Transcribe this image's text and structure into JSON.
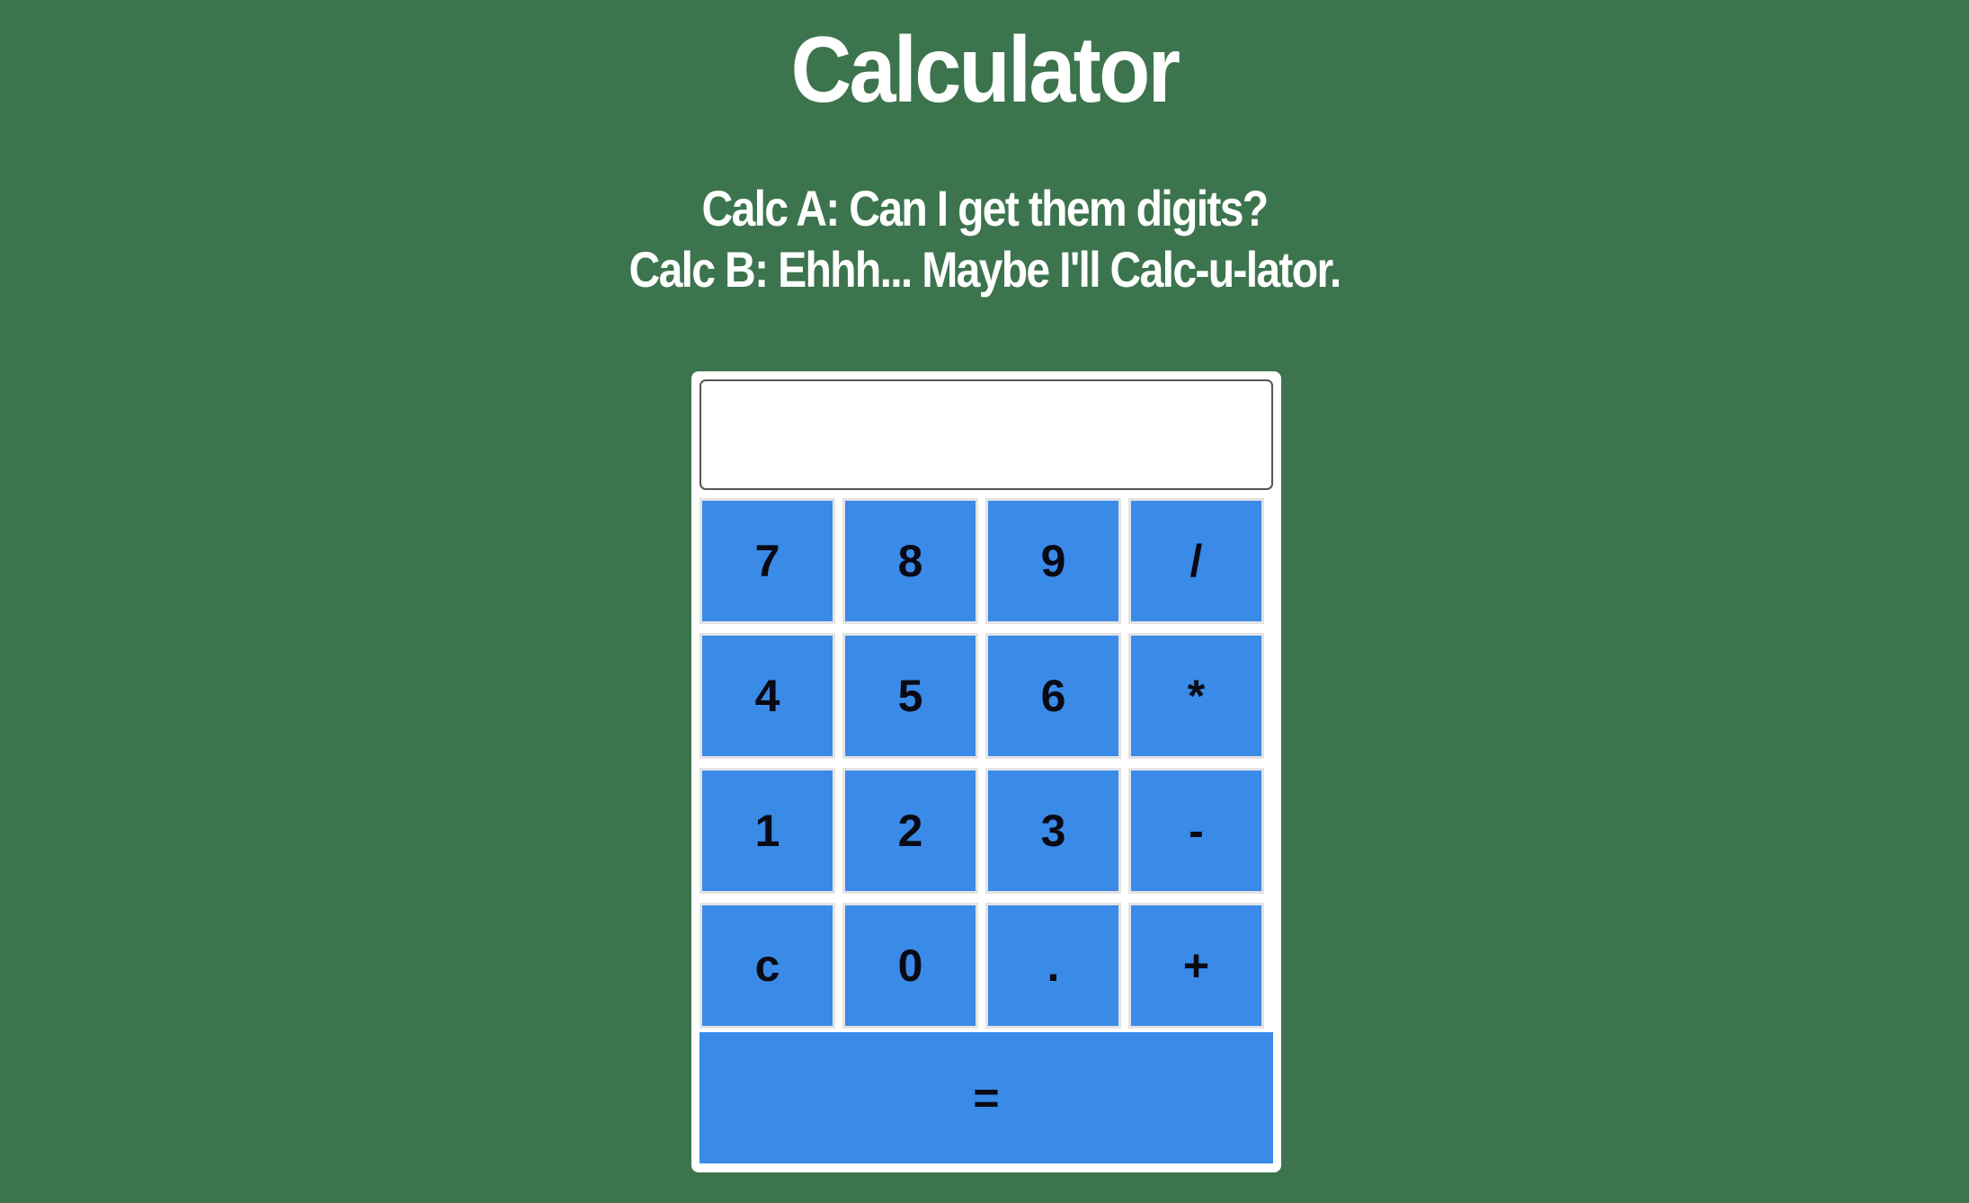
{
  "header": {
    "title": "Calculator",
    "joke_line_a": "Calc A: Can I get them digits?",
    "joke_line_b": "Calc B: Ehhh... Maybe I'll Calc-u-lator."
  },
  "display": {
    "value": ""
  },
  "keys": {
    "k7": "7",
    "k8": "8",
    "k9": "9",
    "divide": "/",
    "k4": "4",
    "k5": "5",
    "k6": "6",
    "multiply": "*",
    "k1": "1",
    "k2": "2",
    "k3": "3",
    "subtract": "-",
    "clear": "c",
    "k0": "0",
    "decimal": ".",
    "add": "+",
    "equals": "="
  },
  "colors": {
    "background": "#3c744e",
    "key": "#3a8ae8",
    "panel": "#ffffff"
  }
}
